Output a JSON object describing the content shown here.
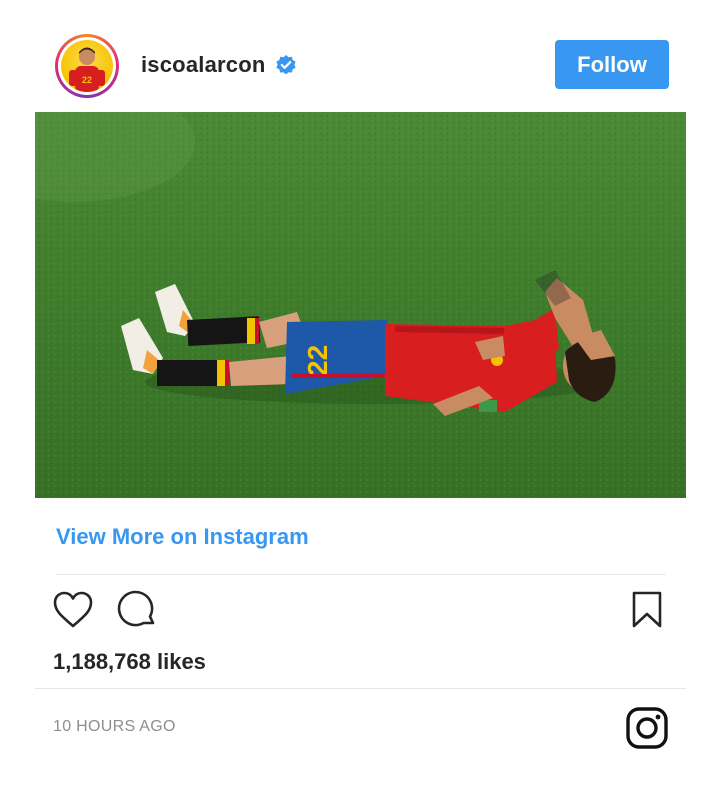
{
  "post": {
    "username": "iscoalarcon",
    "verified": true,
    "follow_label": "Follow",
    "view_more_label": "View More on Instagram",
    "likes_text": "1,188,768 likes",
    "timestamp": "10 HOURS AGO",
    "jersey_number": "22"
  },
  "icons": {
    "verified": "verified-badge-icon",
    "like": "heart-icon",
    "comment": "comment-icon",
    "save": "bookmark-icon",
    "brand": "instagram-logo-icon"
  },
  "colors": {
    "accent": "#3897f0",
    "text": "#262626",
    "muted": "#8e8e8e",
    "divider": "#e6e6e6"
  }
}
